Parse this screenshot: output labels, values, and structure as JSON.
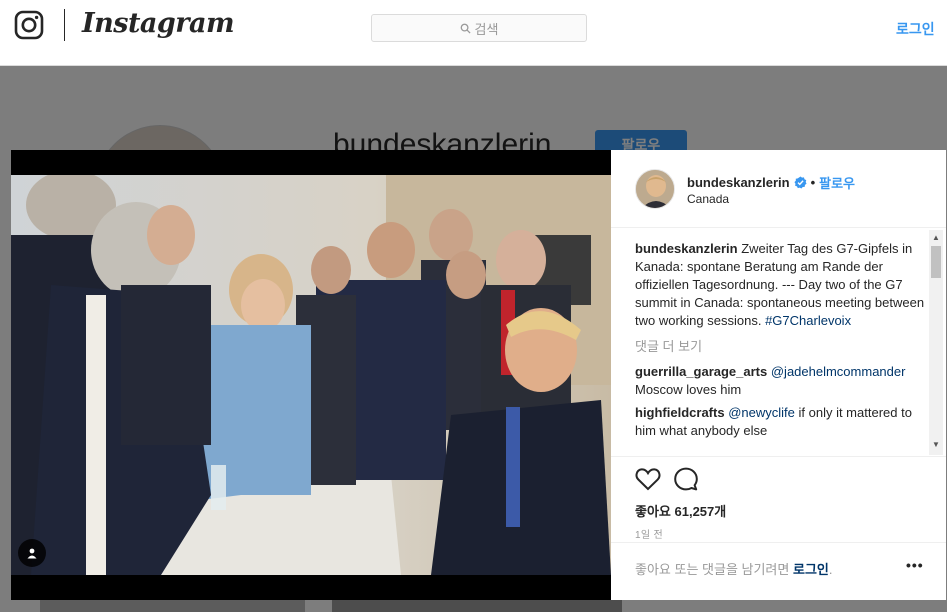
{
  "header": {
    "wordmark": "Instagram",
    "search_placeholder": "검색",
    "login": "로그인"
  },
  "background_profile": {
    "username": "bundeskanzlerin",
    "follow": "팔로우"
  },
  "post": {
    "username": "bundeskanzlerin",
    "separator": "•",
    "follow": "팔로우",
    "location": "Canada",
    "caption_user": "bundeskanzlerin",
    "caption_text": "Zweiter Tag des G7-Gipfels in Kanada: spontane Beratung am Rande der offiziellen Tagesordnung. --- Day two of the G7 summit in Canada: spontaneous meeting between two working sessions.",
    "caption_hashtag": "#G7Charlevoix",
    "more_comments": "댓글 더 보기",
    "comments": [
      {
        "user": "guerrilla_garage_arts",
        "mention": "@jadehelmcommander",
        "text": "Moscow loves him"
      },
      {
        "user": "highfieldcrafts",
        "mention": "@newyclife",
        "text": "if only it mattered to him what anybody else"
      }
    ],
    "likes": "좋아요 61,257개",
    "time_ago": "1일 전",
    "footer_prefix": "좋아요 또는 댓글을 남기려면",
    "footer_login": "로그인",
    "footer_suffix": ".",
    "more_options": "•••"
  },
  "colors": {
    "accent": "#3897f0",
    "link": "#003569",
    "muted": "#999999"
  },
  "icons": [
    "instagram-glyph-icon",
    "search-icon",
    "verified-badge-icon",
    "heart-icon",
    "comment-icon",
    "user-tag-icon",
    "more-options-icon"
  ]
}
